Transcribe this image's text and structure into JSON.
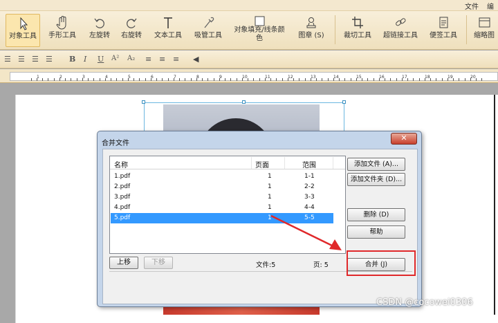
{
  "menu": {
    "file": "文件",
    "edit": "编辑"
  },
  "toolbar": {
    "tools": [
      {
        "label": "对象工具",
        "icon": "cursor-arrow-icon",
        "active": true
      },
      {
        "label": "手形工具",
        "icon": "hand-icon"
      },
      {
        "label": "左旋转",
        "icon": "rotate-left-icon"
      },
      {
        "label": "右旋转",
        "icon": "rotate-right-icon"
      },
      {
        "label": "文本工具",
        "icon": "text-tool-icon"
      },
      {
        "label": "吸管工具",
        "icon": "eyedropper-icon"
      },
      {
        "label": "对象填充/线条颜色",
        "icon": "fill-square-icon"
      },
      {
        "label": "图章 (S)",
        "icon": "stamp-icon"
      },
      {
        "label": "裁切工具",
        "icon": "crop-icon"
      },
      {
        "label": "超链接工具",
        "icon": "link-icon"
      },
      {
        "label": "便签工具",
        "icon": "note-icon"
      },
      {
        "label": "缩略图",
        "icon": "thumbnail-icon"
      }
    ]
  },
  "format_bar": {
    "bold": "B",
    "italic": "I",
    "underline": "U",
    "superscript": "A²",
    "subscript": "A₂"
  },
  "ruler": {
    "marks": [
      "1",
      "2",
      "3",
      "4",
      "5",
      "6",
      "7",
      "8",
      "9",
      "10",
      "11",
      "12",
      "13",
      "14",
      "15",
      "16",
      "17",
      "18",
      "19",
      "20"
    ]
  },
  "dialog": {
    "title": "合并文件",
    "close_label": "✕",
    "columns": {
      "name": "名称",
      "pages": "页面",
      "range": "范围"
    },
    "rows": [
      {
        "name": "1.pdf",
        "pages": "1",
        "range": "1-1"
      },
      {
        "name": "2.pdf",
        "pages": "1",
        "range": "2-2"
      },
      {
        "name": "3.pdf",
        "pages": "1",
        "range": "3-3"
      },
      {
        "name": "4.pdf",
        "pages": "1",
        "range": "4-4"
      },
      {
        "name": "5.pdf",
        "pages": "1",
        "range": "5-5",
        "selected": true
      }
    ],
    "buttons": {
      "add_file": "添加文件 (A)...",
      "add_folder": "添加文件夹 (D)...",
      "delete": "删除 (D)",
      "help": "帮助",
      "merge": "合并 (J)",
      "move_up": "上移",
      "move_down": "下移"
    },
    "status": {
      "files": "文件:5",
      "pages": "页: 5"
    }
  },
  "watermark": "CSDN @cocowei0306",
  "colors": {
    "selection": "#3399ff",
    "highlight": "#e0282a",
    "toolbar": "#f3e6c7"
  }
}
